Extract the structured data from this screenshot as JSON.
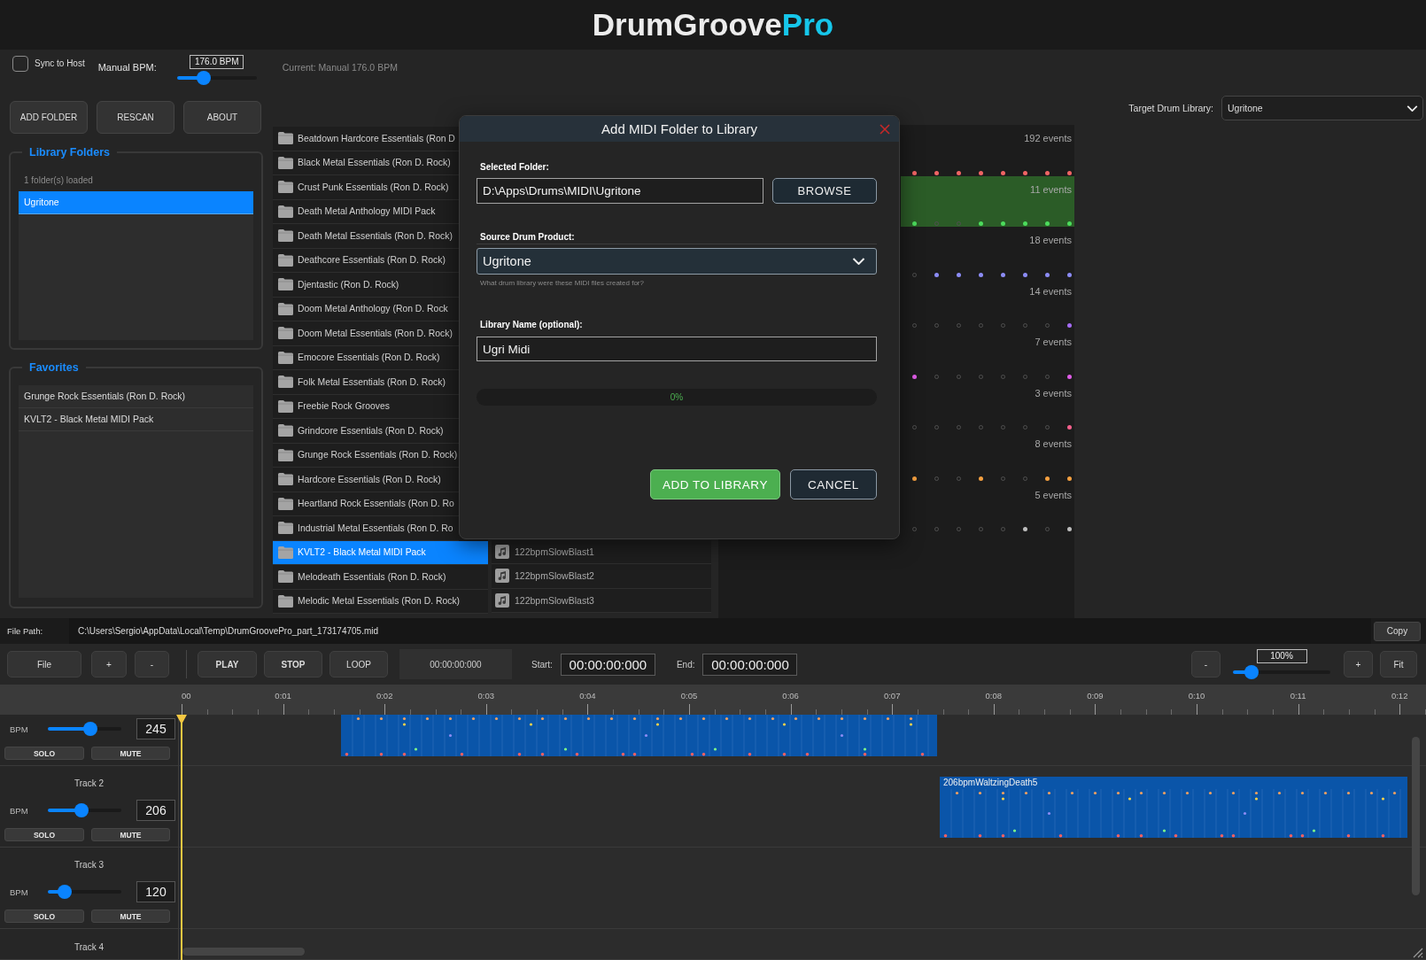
{
  "app_title": {
    "main": "DrumGroove",
    "accent": "Pro"
  },
  "top_bar": {
    "sync_to_host": {
      "label": "Sync to Host",
      "checked": false
    },
    "manual_bpm": {
      "label": "Manual BPM:",
      "value": "176.0 BPM",
      "level": 0.3
    },
    "current": "Current: Manual 176.0 BPM"
  },
  "actions": [
    "ADD FOLDER",
    "RESCAN",
    "ABOUT"
  ],
  "library_folders": {
    "title": "Library Folders",
    "count": "1 folder(s) loaded",
    "items": [
      {
        "label": "Ugritone",
        "selected": true
      }
    ]
  },
  "favorites": {
    "title": "Favorites",
    "items": [
      {
        "label": "Grunge Rock Essentials (Ron D. Rock)",
        "selected": false
      },
      {
        "label": "KVLT2 - Black Metal MIDI Pack",
        "selected": false
      }
    ]
  },
  "packs": [
    {
      "label": "Beatdown Hardcore Essentials (Ron D",
      "selected": false
    },
    {
      "label": "Black Metal Essentials (Ron D. Rock)",
      "selected": false
    },
    {
      "label": "Crust Punk Essentials (Ron D. Rock)",
      "selected": false
    },
    {
      "label": "Death Metal Anthology MIDI Pack",
      "selected": false
    },
    {
      "label": "Death Metal Essentials (Ron D. Rock)",
      "selected": false
    },
    {
      "label": "Deathcore Essentials (Ron D. Rock)",
      "selected": false
    },
    {
      "label": "Djentastic (Ron D. Rock)",
      "selected": false
    },
    {
      "label": "Doom Metal Anthology (Ron D. Rock",
      "selected": false
    },
    {
      "label": "Doom Metal Essentials (Ron D. Rock)",
      "selected": false
    },
    {
      "label": "Emocore Essentials (Ron D. Rock)",
      "selected": false
    },
    {
      "label": "Folk Metal Essentials (Ron D. Rock)",
      "selected": false
    },
    {
      "label": "Freebie Rock Grooves",
      "selected": false
    },
    {
      "label": "Grindcore Essentials (Ron D. Rock)",
      "selected": false
    },
    {
      "label": "Grunge Rock Essentials (Ron D. Rock)",
      "selected": false
    },
    {
      "label": "Hardcore Essentials (Ron D. Rock)",
      "selected": false
    },
    {
      "label": "Heartland Rock Essentials (Ron D. Ro",
      "selected": false
    },
    {
      "label": "Industrial Metal Essentials (Ron D. Ro",
      "selected": false
    },
    {
      "label": "KVLT2 - Black Metal MIDI Pack",
      "selected": true
    },
    {
      "label": "Melodeath Essentials (Ron D. Rock)",
      "selected": false
    },
    {
      "label": "Melodic Metal Essentials (Ron D. Rock)",
      "selected": false
    }
  ],
  "files": [
    {
      "label": "122bpmSlowBlast1",
      "selected": false
    },
    {
      "label": "122bpmSlowBlast2",
      "selected": false
    },
    {
      "label": "122bpmSlowBlast3",
      "selected": false
    }
  ],
  "pattern_lanes": [
    {
      "events": "192 events",
      "color": "#f06464",
      "selected": false,
      "hits": [
        true,
        true,
        true,
        true,
        true,
        true,
        true,
        true
      ]
    },
    {
      "events": "11 events",
      "color": "#4cdc5c",
      "selected": true,
      "hits": [
        true,
        false,
        false,
        true,
        true,
        true,
        true,
        true
      ]
    },
    {
      "events": "18 events",
      "color": "#8c8cf5",
      "selected": false,
      "hits": [
        false,
        true,
        true,
        true,
        true,
        true,
        true,
        true
      ]
    },
    {
      "events": "14 events",
      "color": "#a56cf5",
      "selected": false,
      "hits": [
        false,
        false,
        false,
        false,
        false,
        false,
        false,
        true
      ]
    },
    {
      "events": "7 events",
      "color": "#e05ce8",
      "selected": false,
      "hits": [
        true,
        false,
        false,
        false,
        false,
        false,
        false,
        true
      ]
    },
    {
      "events": "3 events",
      "color": "#f5608c",
      "selected": false,
      "hits": [
        false,
        false,
        false,
        false,
        false,
        false,
        false,
        true
      ]
    },
    {
      "events": "8 events",
      "color": "#f5a040",
      "selected": false,
      "hits": [
        true,
        false,
        false,
        true,
        false,
        false,
        true,
        true
      ]
    },
    {
      "events": "5 events",
      "color": "#bdbdbd",
      "selected": false,
      "hits": [
        false,
        false,
        false,
        false,
        false,
        true,
        false,
        true
      ]
    }
  ],
  "target_library": {
    "label": "Target Drum Library:",
    "value": "Ugritone"
  },
  "dialog": {
    "title": "Add MIDI Folder to Library",
    "folder_label": "Selected Folder:",
    "folder": "D:\\Apps\\Drums\\MIDI\\Ugritone",
    "browse": "BROWSE",
    "source_label": "Source Drum Product:",
    "source": "Ugritone",
    "source_hint": "What drum library were these MIDI files created for?",
    "name_label": "Library Name (optional):",
    "name": "Ugri Midi",
    "progress": {
      "text": "0%",
      "level": 0
    },
    "confirm": "ADD TO LIBRARY",
    "cancel": "CANCEL"
  },
  "file_path": {
    "label": "File Path:",
    "value": "C:\\Users\\Sergio\\AppData\\Local\\Temp\\DrumGroovePro_part_173174705.mid",
    "copy": "Copy"
  },
  "transport": {
    "file": "File",
    "add": "+",
    "remove": "-",
    "play": "PLAY",
    "stop": "STOP",
    "loop": "LOOP",
    "position": "00:00:00:000",
    "start_label": "Start:",
    "start": "00:00:00:000",
    "end_label": "End:",
    "end": "00:00:00:000",
    "zoom_out": "-",
    "zoom": {
      "value": "100%",
      "level": 0.14
    },
    "zoom_in": "+",
    "fit": "Fit"
  },
  "ruler": [
    "00",
    "0:01",
    "0:02",
    "0:03",
    "0:04",
    "0:05",
    "0:06",
    "0:07",
    "0:08",
    "0:09",
    "0:10",
    "0:11",
    "0:12"
  ],
  "tracks": [
    {
      "bpm_label": "BPM",
      "bpm": "245",
      "level": 0.6,
      "solo": "SOLO",
      "mute": "MUTE",
      "clip": true
    },
    {
      "name": "Track 2",
      "bpm_label": "BPM",
      "bpm": "206",
      "level": 0.45,
      "solo": "SOLO",
      "mute": "MUTE",
      "clip": true,
      "clip_label": "206bpmWaltzingDeath5"
    },
    {
      "name": "Track 3",
      "bpm_label": "BPM",
      "bpm": "120",
      "level": 0.16,
      "solo": "SOLO",
      "mute": "MUTE",
      "clip": false
    },
    {
      "name": "Track 4",
      "clip": false
    }
  ]
}
